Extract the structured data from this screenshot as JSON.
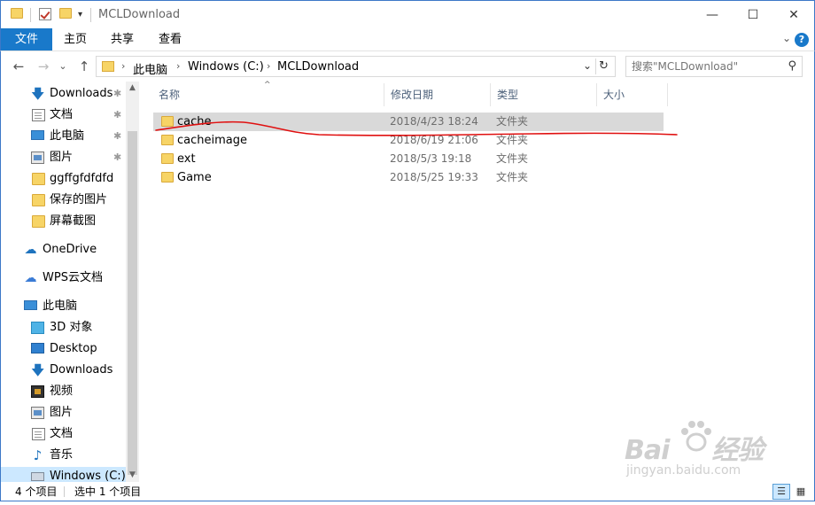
{
  "window": {
    "title": "MCLDownload",
    "minimize_glyph": "—",
    "maximize_glyph": "☐",
    "close_glyph": "✕"
  },
  "ribbon": {
    "tabs": [
      "文件",
      "主页",
      "共享",
      "查看"
    ],
    "expand_glyph": "⌄",
    "help_glyph": "?"
  },
  "nav_buttons": {
    "back": "←",
    "forward": "→",
    "recent": "⌄",
    "up": "↑"
  },
  "address": {
    "crumbs": [
      "此电脑",
      "Windows (C:)",
      "MCLDownload"
    ],
    "separator": "›",
    "dropdown_glyph": "⌄",
    "refresh_glyph": "↻"
  },
  "search": {
    "placeholder": "搜索\"MCLDownload\"",
    "icon": "search-icon"
  },
  "sidebar": {
    "quick_access": [
      {
        "label": "Downloads",
        "icon": "download-icon",
        "pinned": true
      },
      {
        "label": "文档",
        "icon": "document-icon",
        "pinned": true
      },
      {
        "label": "此电脑",
        "icon": "computer-icon",
        "pinned": true
      },
      {
        "label": "图片",
        "icon": "pictures-icon",
        "pinned": true
      },
      {
        "label": "ggffgfdfdfd",
        "icon": "folder-icon",
        "pinned": false
      },
      {
        "label": "保存的图片",
        "icon": "folder-icon",
        "pinned": false
      },
      {
        "label": "屏幕截图",
        "icon": "folder-icon",
        "pinned": false
      }
    ],
    "onedrive": {
      "label": "OneDrive",
      "icon": "cloud-icon"
    },
    "wps": {
      "label": "WPS云文档",
      "icon": "cloud-outline-icon"
    },
    "this_pc": {
      "label": "此电脑",
      "icon": "computer-icon"
    },
    "pc_items": [
      {
        "label": "3D 对象",
        "icon": "cube-icon"
      },
      {
        "label": "Desktop",
        "icon": "desktop-icon"
      },
      {
        "label": "Downloads",
        "icon": "download-icon"
      },
      {
        "label": "视频",
        "icon": "video-icon"
      },
      {
        "label": "图片",
        "icon": "pictures-icon"
      },
      {
        "label": "文档",
        "icon": "document-icon"
      },
      {
        "label": "音乐",
        "icon": "music-icon"
      },
      {
        "label": "Windows (C:)",
        "icon": "drive-icon"
      }
    ],
    "pin_glyph": "📌"
  },
  "file_list": {
    "columns": [
      "名称",
      "修改日期",
      "类型",
      "大小"
    ],
    "sort_glyph": "^",
    "rows": [
      {
        "name": "cache",
        "modified": "2018/4/23 18:24",
        "type": "文件夹",
        "selected": true
      },
      {
        "name": "cacheimage",
        "modified": "2018/6/19 21:06",
        "type": "文件夹",
        "selected": false
      },
      {
        "name": "ext",
        "modified": "2018/5/3 19:18",
        "type": "文件夹",
        "selected": false
      },
      {
        "name": "Game",
        "modified": "2018/5/25 19:33",
        "type": "文件夹",
        "selected": false
      }
    ]
  },
  "annotation": {
    "color": "#e01010"
  },
  "watermark": {
    "logo": "Bai",
    "logo2": "经验",
    "site": "jingyan.baidu.com"
  },
  "status": {
    "item_count": "4 个项目",
    "selection": "选中 1 个项目"
  },
  "colors": {
    "accent": "#1979ca",
    "selected_row": "#d9d9d9",
    "folder": "#f7d466"
  }
}
